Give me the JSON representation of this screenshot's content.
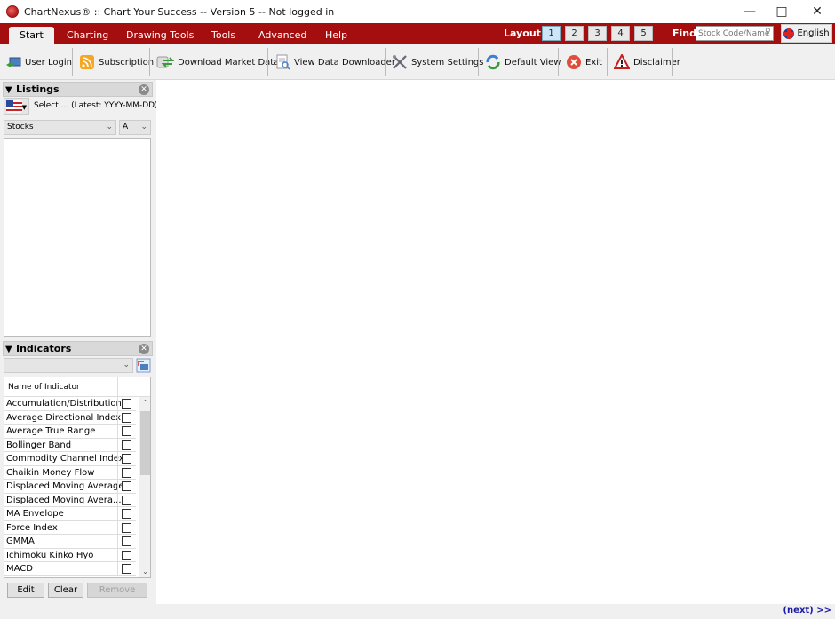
{
  "window": {
    "title": "ChartNexus® :: Chart Your Success -- Version 5 -- Not logged in",
    "controls": [
      "minimize",
      "maximize",
      "close"
    ]
  },
  "menu": {
    "tabs": [
      {
        "label": "Start",
        "active": true
      },
      {
        "label": "Charting"
      },
      {
        "label": "Drawing Tools"
      },
      {
        "label": "Tools"
      },
      {
        "label": "Advanced"
      },
      {
        "label": "Help"
      }
    ],
    "layout_label": "Layout:",
    "layout_options": [
      "1",
      "2",
      "3",
      "4",
      "5"
    ],
    "layout_selected": "1",
    "find_label": "Find",
    "find_placeholder": "Stock Code/Name",
    "language": "English",
    "accent_color": "#a50e0e"
  },
  "toolbar": {
    "items": [
      {
        "label": "User Login",
        "icon": "user-login-icon"
      },
      {
        "label": "Subscription",
        "icon": "rss-icon"
      },
      {
        "label": "Download Market Data",
        "icon": "download-data-icon"
      },
      {
        "label": "View Data Downloader",
        "icon": "document-view-icon"
      },
      {
        "label": "System Settings",
        "icon": "tools-icon"
      },
      {
        "label": "Default View",
        "icon": "refresh-icon"
      },
      {
        "label": "Exit",
        "icon": "exit-icon"
      },
      {
        "label": "Disclaimer",
        "icon": "warning-icon"
      }
    ]
  },
  "listings": {
    "title": "Listings",
    "market_select": "Select ... (Latest: YYYY-MM-DD)",
    "type_select": "Stocks",
    "sort_select": "A"
  },
  "indicators": {
    "title": "Indicators",
    "column_header": "Name of Indicator",
    "items": [
      "Accumulation/Distribution",
      "Average Directional Index",
      "Average True Range",
      "Bollinger Band",
      "Commodity Channel Index",
      "Chaikin Money Flow",
      "Displaced Moving Average",
      "Displaced Moving Avera...",
      "MA Envelope",
      "Force Index",
      "GMMA",
      "Ichimoku Kinko Hyo",
      "MACD"
    ],
    "edit_label": "Edit",
    "clear_label": "Clear",
    "remove_label": "Remove"
  },
  "status": {
    "next_label": "(next) >>"
  }
}
